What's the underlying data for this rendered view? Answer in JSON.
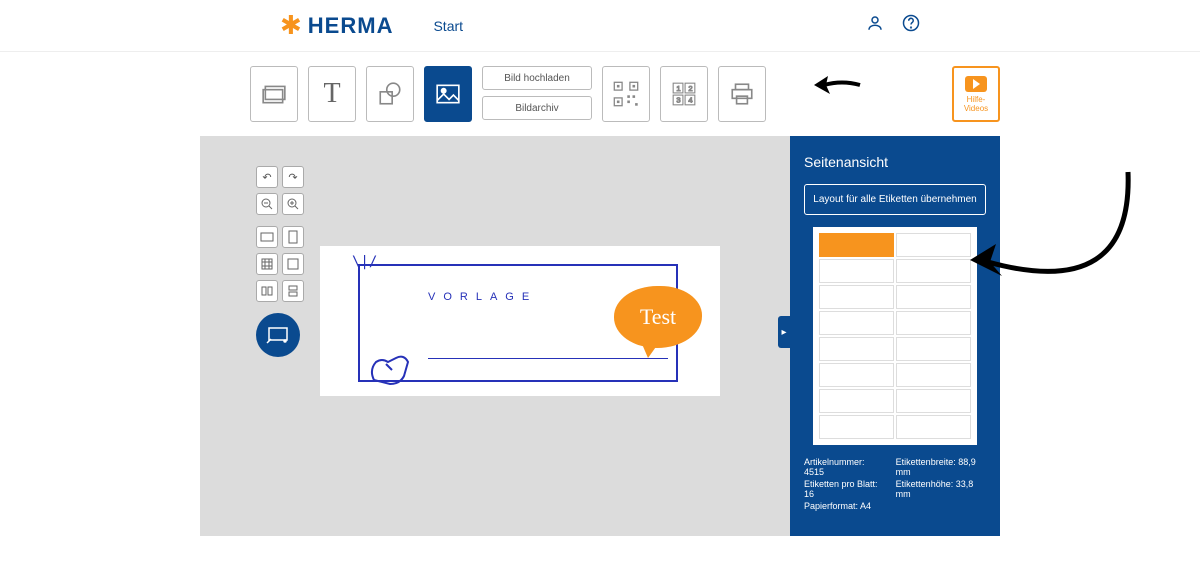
{
  "header": {
    "brand": "HERMA",
    "nav_start": "Start"
  },
  "toolbar": {
    "upload_label": "Bild hochladen",
    "archive_label": "Bildarchiv",
    "help_label": "Hilfe-\nVideos"
  },
  "canvas": {
    "template_label": "VORLAGE",
    "bubble_text": "Test"
  },
  "panel": {
    "title": "Seitenansicht",
    "apply_layout": "Layout für alle Etiketten übernehmen",
    "info": {
      "artikel_label": "Artikelnummer:",
      "artikel_value": "4515",
      "perblatt_label": "Etiketten pro Blatt:",
      "perblatt_value": "16",
      "papier_label": "Papierformat:",
      "papier_value": "A4",
      "breite_label": "Etikettenbreite:",
      "breite_value": "88,9 mm",
      "hoehe_label": "Etikettenhöhe:",
      "hoehe_value": "33,8 mm"
    }
  }
}
